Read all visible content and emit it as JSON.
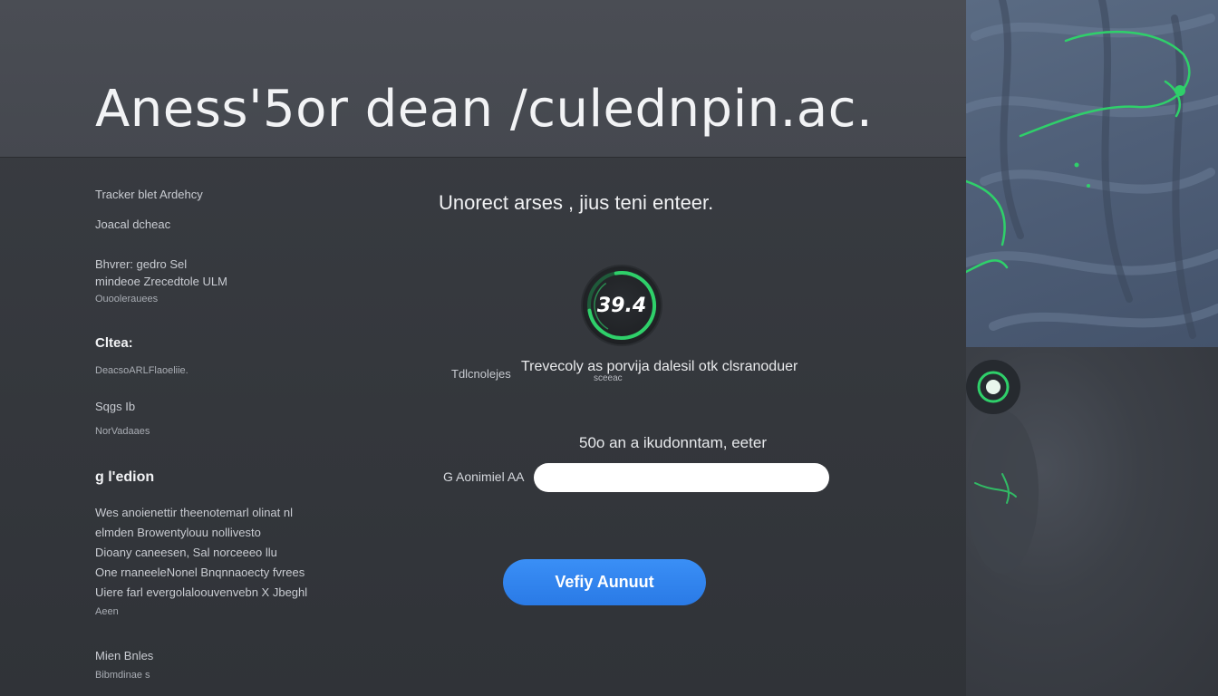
{
  "header": {
    "title": "Aness'5or dean /culednpin.ac."
  },
  "sidebar": {
    "lines": [
      "Tracker blet Ardehcy",
      "Joacal dcheac",
      "Bhvrer: gedro Sel",
      "mindeoe Zrecedtole ULM",
      "Ouoolerauees",
      "Cltea:",
      "DeacsoARLFlaoeliie.",
      "Sqgs Ib",
      "NorVadaaes",
      "g l'edion",
      "Wes anoienettir theenotemarl olinat nl",
      "elmden Browentylouu nollivesto",
      "Dioany caneesen, Sal norceeeo llu",
      "One rnaneeleNonel Bnqnnaoecty fvrees",
      "Uiere farl evergolaloouvenvebn X Jbeghl",
      "Aeen",
      "Mien Bnles",
      "Bibmdinae s"
    ]
  },
  "verify": {
    "headline": "Unorect arses , jius teni enteer.",
    "score_value": "39.4",
    "small_label": "Tdlcnolejes",
    "description": "Trevecoly as porvija dalesil otk clsranoduer",
    "description_sub": "sceeac",
    "prompt": "50o an a ikudonntam, eeter",
    "input_label": "G Aonimiel AA",
    "input_value": "",
    "input_placeholder": "",
    "button_label": "Vefiy Aunuut"
  },
  "colors": {
    "accent_green": "#2fd06a",
    "button_blue": "#2f85f0",
    "background": "#34373d"
  },
  "icons": {
    "score_ring": "circular-progress-icon",
    "side_ring": "ring-dot-icon"
  }
}
